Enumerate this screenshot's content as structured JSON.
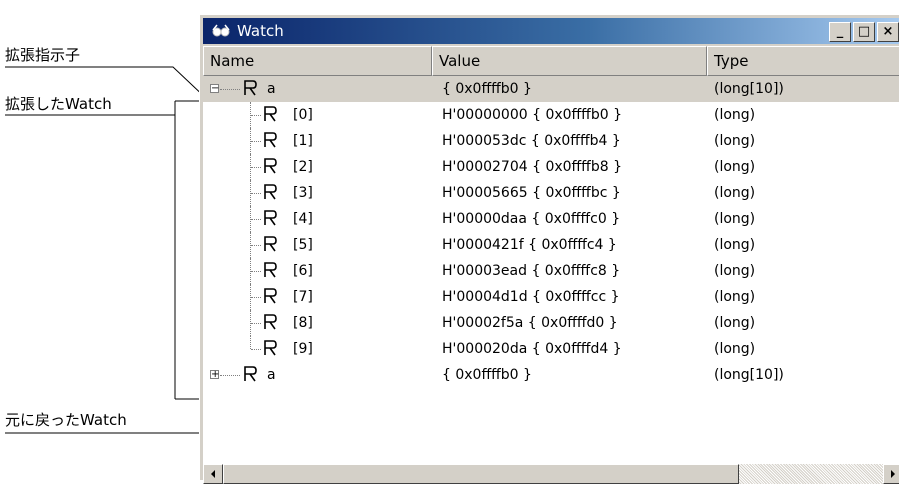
{
  "annotations": {
    "expand_indicator": "拡張指示子",
    "expanded_watch": "拡張したWatch",
    "restored_watch": "元に戻ったWatch"
  },
  "window": {
    "title": "Watch",
    "title_icon": "watch-eyeglasses-icon",
    "buttons": {
      "minimize": "_",
      "maximize": "□",
      "close": "×"
    }
  },
  "columns": {
    "name": "Name",
    "value": "Value",
    "type": "Type"
  },
  "rows": [
    {
      "name": "a",
      "value": "{ 0x0ffffb0 }",
      "type": "(long[10])",
      "icon": "register-icon",
      "expander": "−",
      "selected": true
    },
    {
      "name": "[0]",
      "value": "H'00000000 { 0x0ffffb0 }",
      "type": "(long)",
      "icon": "register-icon"
    },
    {
      "name": "[1]",
      "value": "H'000053dc { 0x0ffffb4 }",
      "type": "(long)",
      "icon": "register-icon"
    },
    {
      "name": "[2]",
      "value": "H'00002704 { 0x0ffffb8 }",
      "type": "(long)",
      "icon": "register-icon"
    },
    {
      "name": "[3]",
      "value": "H'00005665 { 0x0ffffbc }",
      "type": "(long)",
      "icon": "register-icon"
    },
    {
      "name": "[4]",
      "value": "H'00000daa { 0x0ffffc0 }",
      "type": "(long)",
      "icon": "register-icon"
    },
    {
      "name": "[5]",
      "value": "H'0000421f { 0x0ffffc4 }",
      "type": "(long)",
      "icon": "register-icon"
    },
    {
      "name": "[6]",
      "value": "H'00003ead { 0x0ffffc8 }",
      "type": "(long)",
      "icon": "register-icon"
    },
    {
      "name": "[7]",
      "value": "H'00004d1d { 0x0ffffcc }",
      "type": "(long)",
      "icon": "register-icon"
    },
    {
      "name": "[8]",
      "value": "H'00002f5a { 0x0ffffd0 }",
      "type": "(long)",
      "icon": "register-icon"
    },
    {
      "name": "[9]",
      "value": "H'000020da { 0x0ffffd4 }",
      "type": "(long)",
      "icon": "register-icon"
    },
    {
      "name": "a",
      "value": "{ 0x0ffffb0 }",
      "type": "(long[10])",
      "icon": "register-icon",
      "expander": "+"
    }
  ],
  "colors": {
    "title_start": "#0a246a",
    "title_end": "#a6caf0",
    "face": "#d4d0c8"
  }
}
